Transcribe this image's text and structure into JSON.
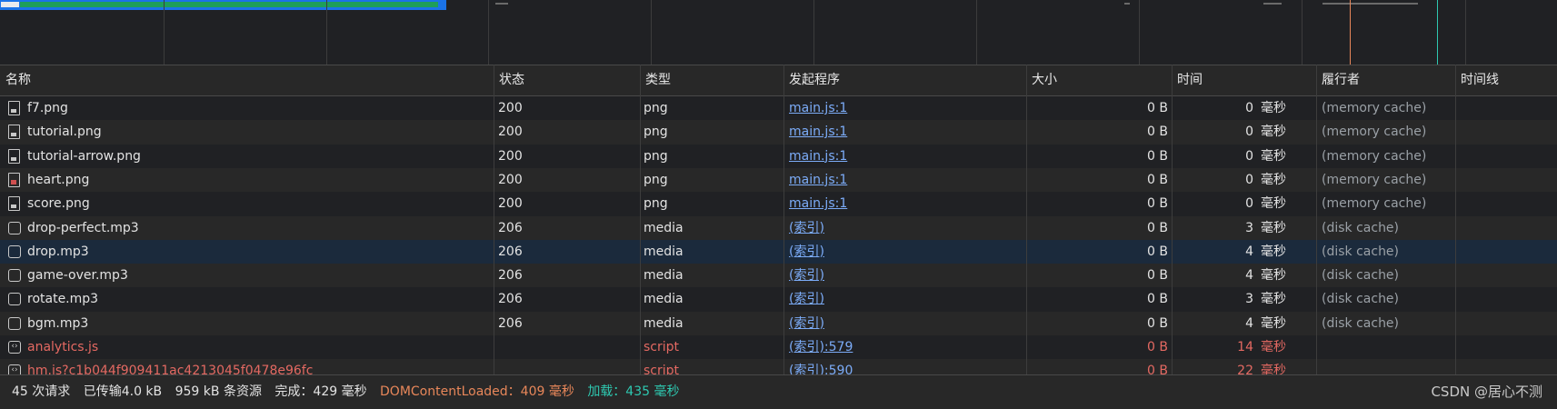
{
  "columns": {
    "name": "名称",
    "status": "状态",
    "type": "类型",
    "initiator": "发起程序",
    "size": "大小",
    "time": "时间",
    "fulfilled": "履行者",
    "waterfall": "时间线"
  },
  "rows": [
    {
      "icon": "image-file-icon",
      "name": "f7.png",
      "status": "200",
      "type": "png",
      "initiator": "main.js:1",
      "size": "0 B",
      "time": "0",
      "unit": "毫秒",
      "fulfilled": "(memory cache)",
      "error": false
    },
    {
      "icon": "image-file-icon",
      "name": "tutorial.png",
      "status": "200",
      "type": "png",
      "initiator": "main.js:1",
      "size": "0 B",
      "time": "0",
      "unit": "毫秒",
      "fulfilled": "(memory cache)",
      "error": false
    },
    {
      "icon": "image-file-icon",
      "name": "tutorial-arrow.png",
      "status": "200",
      "type": "png",
      "initiator": "main.js:1",
      "size": "0 B",
      "time": "0",
      "unit": "毫秒",
      "fulfilled": "(memory cache)",
      "error": false
    },
    {
      "icon": "heart-image-icon",
      "name": "heart.png",
      "status": "200",
      "type": "png",
      "initiator": "main.js:1",
      "size": "0 B",
      "time": "0",
      "unit": "毫秒",
      "fulfilled": "(memory cache)",
      "error": false
    },
    {
      "icon": "image-file-icon",
      "name": "score.png",
      "status": "200",
      "type": "png",
      "initiator": "main.js:1",
      "size": "0 B",
      "time": "0",
      "unit": "毫秒",
      "fulfilled": "(memory cache)",
      "error": false
    },
    {
      "icon": "media-file-icon",
      "name": "drop-perfect.mp3",
      "status": "206",
      "type": "media",
      "initiator": "(索引)",
      "size": "0 B",
      "time": "3",
      "unit": "毫秒",
      "fulfilled": "(disk cache)",
      "error": false
    },
    {
      "icon": "media-file-icon",
      "name": "drop.mp3",
      "status": "206",
      "type": "media",
      "initiator": "(索引)",
      "size": "0 B",
      "time": "4",
      "unit": "毫秒",
      "fulfilled": "(disk cache)",
      "error": false,
      "selected": true
    },
    {
      "icon": "media-file-icon",
      "name": "game-over.mp3",
      "status": "206",
      "type": "media",
      "initiator": "(索引)",
      "size": "0 B",
      "time": "4",
      "unit": "毫秒",
      "fulfilled": "(disk cache)",
      "error": false
    },
    {
      "icon": "media-file-icon",
      "name": "rotate.mp3",
      "status": "206",
      "type": "media",
      "initiator": "(索引)",
      "size": "0 B",
      "time": "3",
      "unit": "毫秒",
      "fulfilled": "(disk cache)",
      "error": false
    },
    {
      "icon": "media-file-icon",
      "name": "bgm.mp3",
      "status": "206",
      "type": "media",
      "initiator": "(索引)",
      "size": "0 B",
      "time": "4",
      "unit": "毫秒",
      "fulfilled": "(disk cache)",
      "error": false
    },
    {
      "icon": "script-file-icon",
      "name": "analytics.js",
      "status": "",
      "type": "script",
      "initiator": "(索引):579",
      "size": "0 B",
      "time": "14",
      "unit": "毫秒",
      "fulfilled": "",
      "error": true
    },
    {
      "icon": "script-file-icon",
      "name": "hm.js?c1b044f909411ac4213045f0478e96fc",
      "status": "",
      "type": "script",
      "initiator": "(索引):590",
      "size": "0 B",
      "time": "22",
      "unit": "毫秒",
      "fulfilled": "",
      "error": true
    }
  ],
  "status_bar": {
    "requests": "45 次请求",
    "transferred": "已传输4.0 kB",
    "resources": "959 kB 条资源",
    "finish": "完成：429 毫秒",
    "dcl": "DOMContentLoaded：409 毫秒",
    "load": "加载：435 毫秒",
    "watermark": "CSDN @居心不测"
  },
  "colors": {
    "background": "#202124",
    "error": "#e46962",
    "link": "#7cacf8",
    "dcl": "#e8875a",
    "load": "#2ec8b0"
  }
}
